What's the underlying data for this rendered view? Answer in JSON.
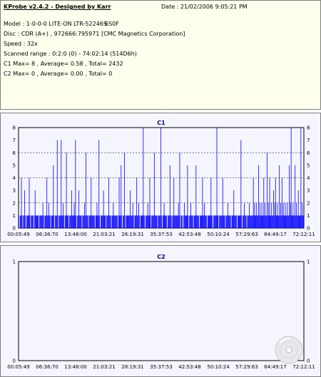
{
  "info": {
    "title": "KProbe v2.4.2 - Designed by Karr",
    "date": "Date : 21/02/2006 9:05:21 PM",
    "model": "Model : 1-0-0-0 LITE-ON LTR-52246S",
    "firmware": "6S0F",
    "disc": "Disc : CDR (A+) , 972666:795971 [CMC Magnetics Corporation]",
    "speed": "Speed : 32x",
    "range": "Scanned range : 0:2:0 (0) - 74:02:14 (514D6h)",
    "c1_stats": "C1 Max= 8 , Average= 0.58 , Total= 2432",
    "c2_stats": "C2 Max= 0 , Average= 0.00 , Total= 0"
  },
  "colors": {
    "bar": "#0000ff",
    "plot_bg": "#f5f5ff",
    "axis": "#000000",
    "title": "#00007f",
    "grid": "#000000"
  },
  "icons": {
    "watermark": "cd-disc-icon"
  },
  "chart_data": [
    {
      "type": "bar",
      "title": "C1",
      "xlabel": "",
      "ylabel": "",
      "ylim": [
        0,
        8
      ],
      "yticks": [
        0,
        1,
        2,
        3,
        4,
        5,
        6,
        7,
        8
      ],
      "xticks": [
        "00:05:49",
        "06:36:70",
        "13:48:00",
        "21:03:21",
        "28:19:31",
        "35:37:53",
        "42:53:48",
        "50:10:24",
        "57:29:63",
        "64:49:17",
        "72:12:11"
      ],
      "grid": "dashed horizontal at 2,4,6,8",
      "x_range": [
        "00:05:49",
        "74:02:14"
      ],
      "values": [
        1,
        0,
        1,
        1,
        4,
        1,
        0,
        1,
        1,
        3,
        1,
        0,
        1,
        1,
        1,
        1,
        4,
        1,
        0,
        1,
        1,
        1,
        1,
        0,
        1,
        3,
        1,
        1,
        1,
        1,
        1,
        0,
        1,
        1,
        1,
        1,
        1,
        2,
        1,
        0,
        1,
        1,
        1,
        4,
        1,
        1,
        2,
        1,
        1,
        0,
        1,
        1,
        1,
        5,
        1,
        0,
        1,
        1,
        1,
        7,
        1,
        0,
        1,
        1,
        1,
        7,
        1,
        1,
        2,
        1,
        0,
        1,
        1,
        6,
        1,
        1,
        1,
        0,
        1,
        1,
        1,
        3,
        1,
        1,
        1,
        2,
        1,
        7,
        1,
        0,
        1,
        1,
        3,
        1,
        1,
        1,
        1,
        0,
        1,
        1,
        1,
        2,
        1,
        6,
        1,
        1,
        1,
        0,
        1,
        1,
        1,
        4,
        1,
        1,
        1,
        1,
        1,
        0,
        1,
        1,
        2,
        1,
        1,
        7,
        1,
        0,
        1,
        1,
        1,
        1,
        3,
        1,
        1,
        1,
        0,
        1,
        1,
        1,
        4,
        1,
        1,
        1,
        0,
        1,
        1,
        2,
        1,
        1,
        1,
        1,
        1,
        1,
        0,
        1,
        4,
        1,
        1,
        5,
        1,
        0,
        1,
        1,
        6,
        1,
        0,
        1,
        1,
        1,
        1,
        1,
        1,
        3,
        1,
        1,
        1,
        2,
        1,
        0,
        1,
        1,
        1,
        4,
        1,
        1,
        2,
        1,
        0,
        1,
        1,
        1,
        1,
        8,
        1,
        1,
        0,
        1,
        1,
        1,
        2,
        1,
        1,
        4,
        1,
        0,
        1,
        1,
        1,
        1,
        6,
        1,
        1,
        1,
        1,
        0,
        1,
        1,
        1,
        1,
        8,
        1,
        0,
        1,
        1,
        2,
        1,
        1,
        1,
        1,
        0,
        1,
        1,
        1,
        5,
        1,
        1,
        0,
        1,
        1,
        4,
        1,
        1,
        1,
        1,
        1,
        1,
        2,
        1,
        6,
        0,
        1,
        1,
        1,
        0,
        1,
        2,
        1,
        1,
        1,
        1,
        5,
        1,
        0,
        1,
        1,
        2,
        1,
        1,
        1,
        0,
        1,
        1,
        1,
        5,
        1,
        1,
        1,
        1,
        0,
        1,
        1,
        1,
        1,
        4,
        1,
        1,
        2,
        1,
        1,
        1,
        0,
        1,
        1,
        1,
        1,
        1,
        4,
        1,
        1,
        0,
        1,
        1,
        1,
        1,
        1,
        8,
        1,
        1,
        0,
        1,
        1,
        1,
        1,
        1,
        4,
        1,
        1,
        1,
        0,
        1,
        1,
        1,
        2,
        1,
        1,
        1,
        1,
        0,
        1,
        1,
        1,
        3,
        1,
        1,
        1,
        1,
        0,
        1,
        1,
        1,
        1,
        1,
        7,
        1,
        0,
        1,
        1,
        2,
        1,
        1,
        1,
        0,
        1,
        1,
        1,
        2,
        1,
        1,
        1,
        1,
        1,
        4,
        1,
        2,
        1,
        1,
        2,
        1,
        1,
        5,
        1,
        2,
        1,
        1,
        2,
        1,
        1,
        4,
        1,
        2,
        1,
        1,
        6,
        1,
        2,
        1,
        4,
        1,
        1,
        2,
        1,
        1,
        3,
        1,
        2,
        4,
        1,
        1,
        2,
        1,
        1,
        5,
        1,
        2,
        1,
        4,
        1,
        2,
        1,
        1,
        2,
        1,
        1,
        2,
        1,
        1,
        5,
        1,
        2,
        8,
        1,
        1,
        2,
        1,
        1,
        5,
        1,
        2,
        1,
        1,
        3,
        1,
        1,
        1,
        8,
        1,
        2,
        1,
        1
      ]
    },
    {
      "type": "bar",
      "title": "C2",
      "xlabel": "",
      "ylabel": "",
      "ylim": [
        0,
        1
      ],
      "yticks": [
        0,
        1
      ],
      "xticks": [
        "00:05:49",
        "06:36:70",
        "13:48:00",
        "21:03:21",
        "28:19:31",
        "35:37:53",
        "42:53:48",
        "50:10:24",
        "57:29:63",
        "64:49:17",
        "72:12:11"
      ],
      "grid": "none",
      "x_range": [
        "00:05:49",
        "74:02:14"
      ],
      "values": [
        0
      ]
    }
  ]
}
